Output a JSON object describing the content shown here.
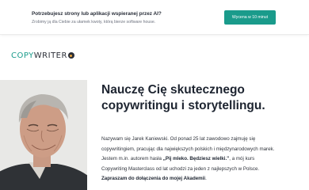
{
  "promo": {
    "title": "Potrzebujesz strony lub aplikacji wspieranej przez AI?",
    "subtitle": "Zrobimy ją dla Ciebie za ułamek kwoty, którą bierze software house.",
    "cta_label": "Wycena w 10 minut"
  },
  "logo": {
    "text_part1": "COPY",
    "text_part2": "WRITER",
    "icon": "logo-badge"
  },
  "hero": {
    "heading": "Nauczę Cię skutecznego copywritingu i storytellingu.",
    "intro": "Nazywam się Jarek Kaniewski. Od ponad 25 lat zawodowo zajmuję się copywritingiem, pracując dla największych polskich i międzynarodowych marek. Jestem m.in. autorem hasła ",
    "slogan": "„Pij mleko. Będziesz wielki.”",
    "middle": ", a mój kurs Copywriting Masterclass od lat uchodzi za jeden z najlepszych w Polsce. ",
    "cta_text": "Zapraszam do dołączenia do mojej Akademii",
    "tail": "."
  },
  "colors": {
    "accent": "#1a9b8b",
    "heading": "#1d2430"
  }
}
